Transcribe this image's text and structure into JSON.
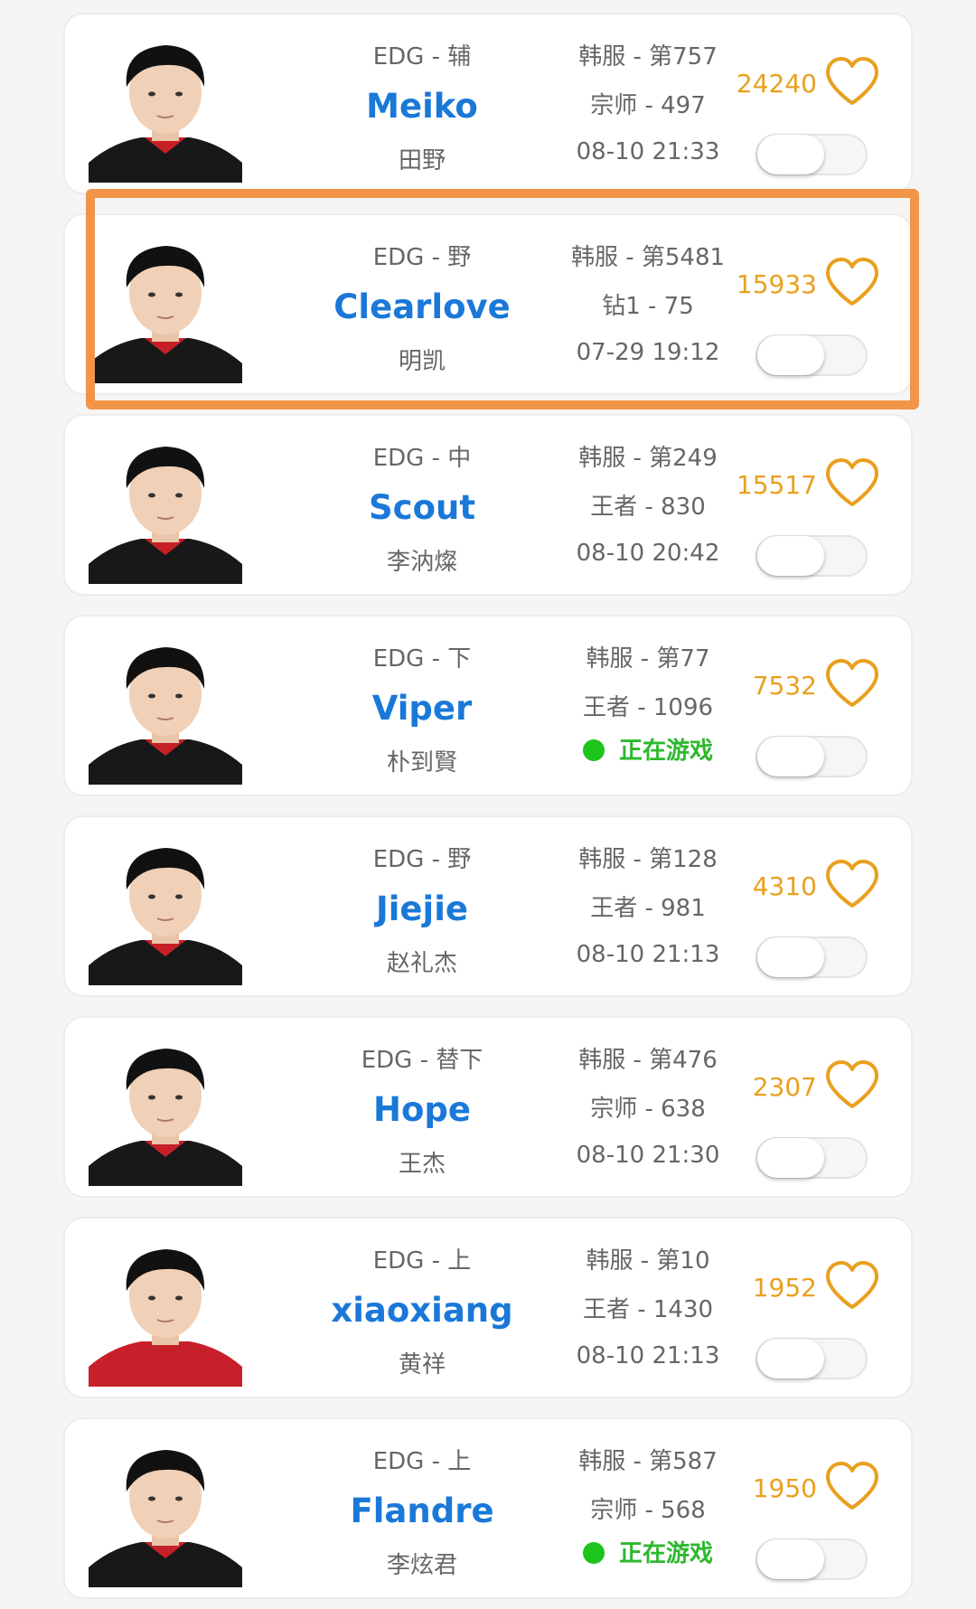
{
  "accent_colors": {
    "nickname": "#1a78d8",
    "likes": "#e9a01f",
    "live": "#2db82d",
    "highlight": "#f29549"
  },
  "players": [
    {
      "team_role": "EDG - 辅",
      "nickname": "Meiko",
      "realname": "田野",
      "server_rank": "韩服 - 第757",
      "tier_points": "宗师 - 497",
      "time": "08-10 21:33",
      "live": false,
      "likes": "24240",
      "subscribed": false,
      "jersey": "#181818"
    },
    {
      "team_role": "EDG - 野",
      "nickname": "Clearlove",
      "realname": "明凯",
      "server_rank": "韩服 - 第5481",
      "tier_points": "钻1 - 75",
      "time": "07-29 19:12",
      "live": false,
      "likes": "15933",
      "subscribed": false,
      "jersey": "#181818"
    },
    {
      "team_role": "EDG - 中",
      "nickname": "Scout",
      "realname": "李汭燦",
      "server_rank": "韩服 - 第249",
      "tier_points": "王者 - 830",
      "time": "08-10 20:42",
      "live": false,
      "likes": "15517",
      "subscribed": false,
      "jersey": "#181818"
    },
    {
      "team_role": "EDG - 下",
      "nickname": "Viper",
      "realname": "朴到賢",
      "server_rank": "韩服 - 第77",
      "tier_points": "王者 - 1096",
      "time": "",
      "live": true,
      "live_label": "正在游戏",
      "likes": "7532",
      "subscribed": false,
      "jersey": "#181818"
    },
    {
      "team_role": "EDG - 野",
      "nickname": "Jiejie",
      "realname": "赵礼杰",
      "server_rank": "韩服 - 第128",
      "tier_points": "王者 - 981",
      "time": "08-10 21:13",
      "live": false,
      "likes": "4310",
      "subscribed": false,
      "jersey": "#181818"
    },
    {
      "team_role": "EDG - 替下",
      "nickname": "Hope",
      "realname": "王杰",
      "server_rank": "韩服 - 第476",
      "tier_points": "宗师 - 638",
      "time": "08-10 21:30",
      "live": false,
      "likes": "2307",
      "subscribed": false,
      "jersey": "#181818"
    },
    {
      "team_role": "EDG - 上",
      "nickname": "xiaoxiang",
      "realname": "黄祥",
      "server_rank": "韩服 - 第10",
      "tier_points": "王者 - 1430",
      "time": "08-10 21:13",
      "live": false,
      "likes": "1952",
      "subscribed": false,
      "jersey": "#c8202a"
    },
    {
      "team_role": "EDG - 上",
      "nickname": "Flandre",
      "realname": "李炫君",
      "server_rank": "韩服 - 第587",
      "tier_points": "宗师 - 568",
      "time": "",
      "live": true,
      "live_label": "正在游戏",
      "likes": "1950",
      "subscribed": false,
      "jersey": "#181818"
    }
  ]
}
